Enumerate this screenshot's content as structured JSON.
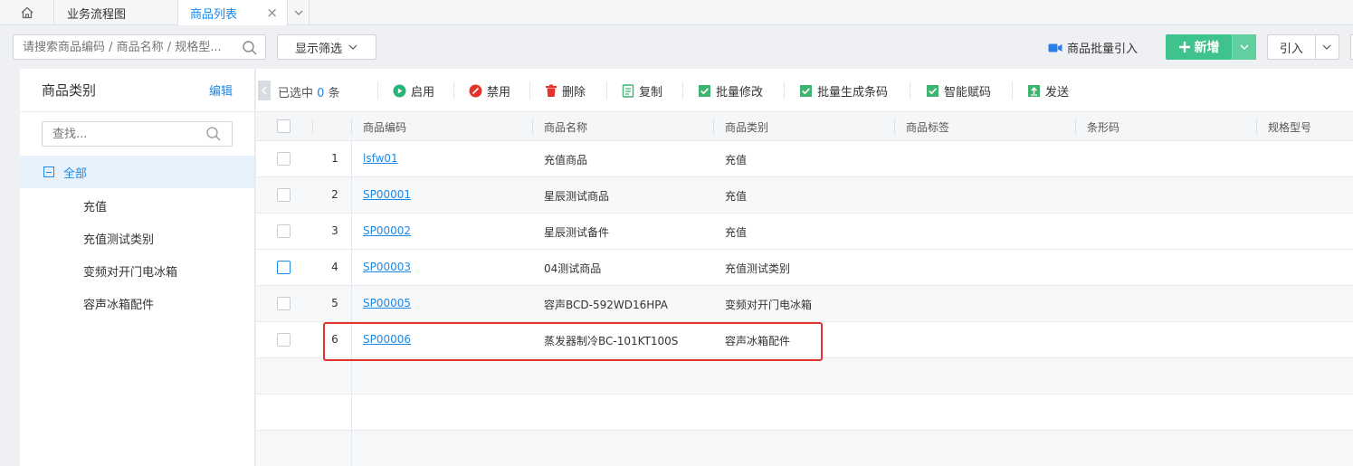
{
  "tabs": {
    "home_icon": "home-icon",
    "flow_label": "业务流程图",
    "active_label": "商品列表",
    "close_glyph": "×"
  },
  "topbar": {
    "search_placeholder": "请搜索商品编码 / 商品名称 / 规格型...",
    "filter_label": "显示筛选",
    "batch_import_label": "商品批量引入",
    "add_label": "新增",
    "import_label": "引入"
  },
  "left_panel": {
    "title": "商品类别",
    "edit_label": "编辑",
    "search_placeholder": "查找...",
    "root_label": "全部",
    "items": [
      {
        "label": "充值"
      },
      {
        "label": "充值测试类别"
      },
      {
        "label": "变频对开门电冰箱"
      },
      {
        "label": "容声冰箱配件"
      }
    ]
  },
  "action_bar": {
    "selected_prefix": "已选中",
    "selected_count": "0",
    "selected_suffix": "条",
    "actions": [
      {
        "label": "启用",
        "icon": "play-circle-icon",
        "color": "#27b37a"
      },
      {
        "label": "禁用",
        "icon": "ban-icon",
        "color": "#e5322d"
      },
      {
        "label": "删除",
        "icon": "trash-icon",
        "color": "#e5322d"
      },
      {
        "label": "复制",
        "icon": "copy-icon",
        "color": "#3fb46e"
      },
      {
        "label": "批量修改",
        "icon": "check-square-icon",
        "color": "#3fb46e"
      },
      {
        "label": "批量生成条码",
        "icon": "check-square-icon",
        "color": "#3fb46e"
      },
      {
        "label": "智能赋码",
        "icon": "check-square-icon",
        "color": "#3fb46e"
      },
      {
        "label": "发送",
        "icon": "upload-icon",
        "color": "#3fb46e"
      }
    ]
  },
  "table": {
    "columns": [
      "商品编码",
      "商品名称",
      "商品类别",
      "商品标签",
      "条形码",
      "规格型号"
    ],
    "rows": [
      {
        "index": "1",
        "code": "lsfw01",
        "name": "充值商品",
        "category": "充值"
      },
      {
        "index": "2",
        "code": "SP00001",
        "name": "星辰测试商品",
        "category": "充值"
      },
      {
        "index": "3",
        "code": "SP00002",
        "name": "星辰测试备件",
        "category": "充值"
      },
      {
        "index": "4",
        "code": "SP00003",
        "name": "04测试商品",
        "category": "充值测试类别"
      },
      {
        "index": "5",
        "code": "SP00005",
        "name": "容声BCD-592WD16HPA",
        "category": "变频对开门电冰箱"
      },
      {
        "index": "6",
        "code": "SP00006",
        "name": "蒸发器制冷BC-101KT100S",
        "category": "容声冰箱配件"
      }
    ]
  },
  "colors": {
    "accent": "#1e88e5",
    "add_button": "#3fc28b",
    "highlight_border": "#e5322d"
  }
}
